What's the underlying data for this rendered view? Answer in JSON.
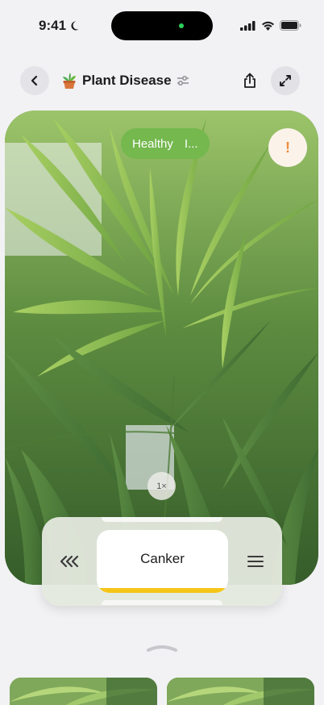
{
  "status_bar": {
    "time": "9:41",
    "accent": "#2bd15a"
  },
  "header": {
    "title": "Plant Disease",
    "title_icon": "potted-plant-icon",
    "left_icon": "chevron-left-icon",
    "filter_icon": "sliders-icon",
    "share_icon": "share-icon",
    "expand_icon": "expand-arrows-icon"
  },
  "photo": {
    "status_pill": "Healthy",
    "status_pill_suffix": "I...",
    "status_color": "#74b84e",
    "alert_symbol": "!",
    "zoom": "1×"
  },
  "picker": {
    "selected": "Canker",
    "accent": "#f5c518",
    "left_icon": "rewind-icon",
    "right_icon": "menu-icon"
  }
}
